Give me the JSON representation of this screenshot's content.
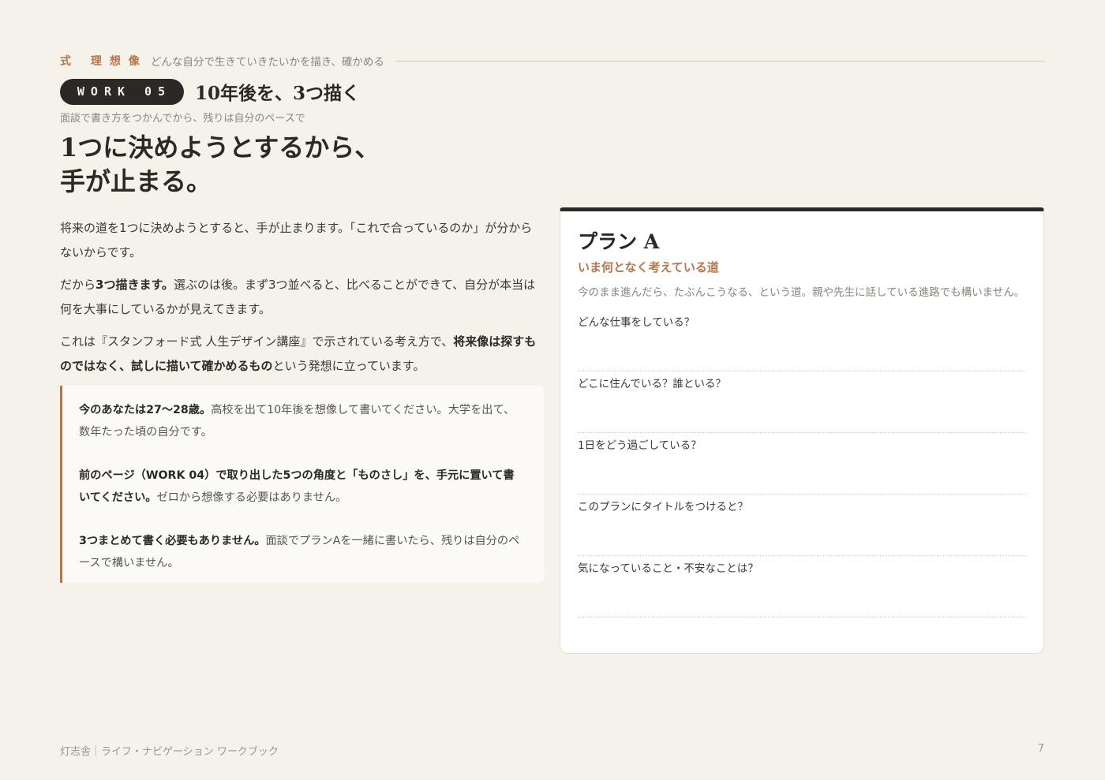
{
  "chapter": {
    "label": "式 理想像",
    "subtitle": "どんな自分で生きていきたいかを描き、確かめる"
  },
  "work": {
    "badge": "WORK 05",
    "title": "10年後を、3つ描く",
    "subcaption": "面談で書き方をつかんでから、残りは自分のペースで"
  },
  "headline": {
    "line1": "1つに決めようとするから、",
    "line2": "手が止まる。"
  },
  "body": {
    "p1": "将来の道を1つに決めようとすると、手が止まります。「これで合っているのか」が分からないからです。",
    "p2_a": "だから",
    "p2_bold": "3つ描きます。",
    "p2_b": "選ぶのは後。まず3つ並べると、比べることができて、自分が本当は何を大事にしているかが見えてきます。",
    "p3_a": "これは『スタンフォード式 人生デザイン講座』で示されている考え方で、",
    "p3_bold": "将来像は探すものではなく、試しに描いて確かめるもの",
    "p3_b": "という発想に立っています。"
  },
  "note": {
    "n1_bold": "今のあなたは27〜28歳。",
    "n1": "高校を出て10年後を想像して書いてください。大学を出て、数年たった頃の自分です。",
    "n2_bold": "前のページ（WORK 04）で取り出した5つの角度と「ものさし」を、手元に置いて書いてください。",
    "n2": "ゼロから想像する必要はありません。",
    "n3_bold": "3つまとめて書く必要もありません。",
    "n3": "面談でプランAを一緒に書いたら、残りは自分のペースで構いません。"
  },
  "card": {
    "title": "プラン A",
    "subtitle": "いま何となく考えている道",
    "description": "今のまま進んだら、たぶんこうなる、という道。親や先生に話している進路でも構いません。",
    "questions": [
      "どんな仕事をしている？",
      "どこに住んでいる？誰といる？",
      "1日をどう過ごしている？",
      "このプランにタイトルをつけると？",
      "気になっていること・不安なことは？"
    ]
  },
  "footer": {
    "left": "灯志舎｜ライフ・ナビゲーション ワークブック",
    "page": "7"
  }
}
